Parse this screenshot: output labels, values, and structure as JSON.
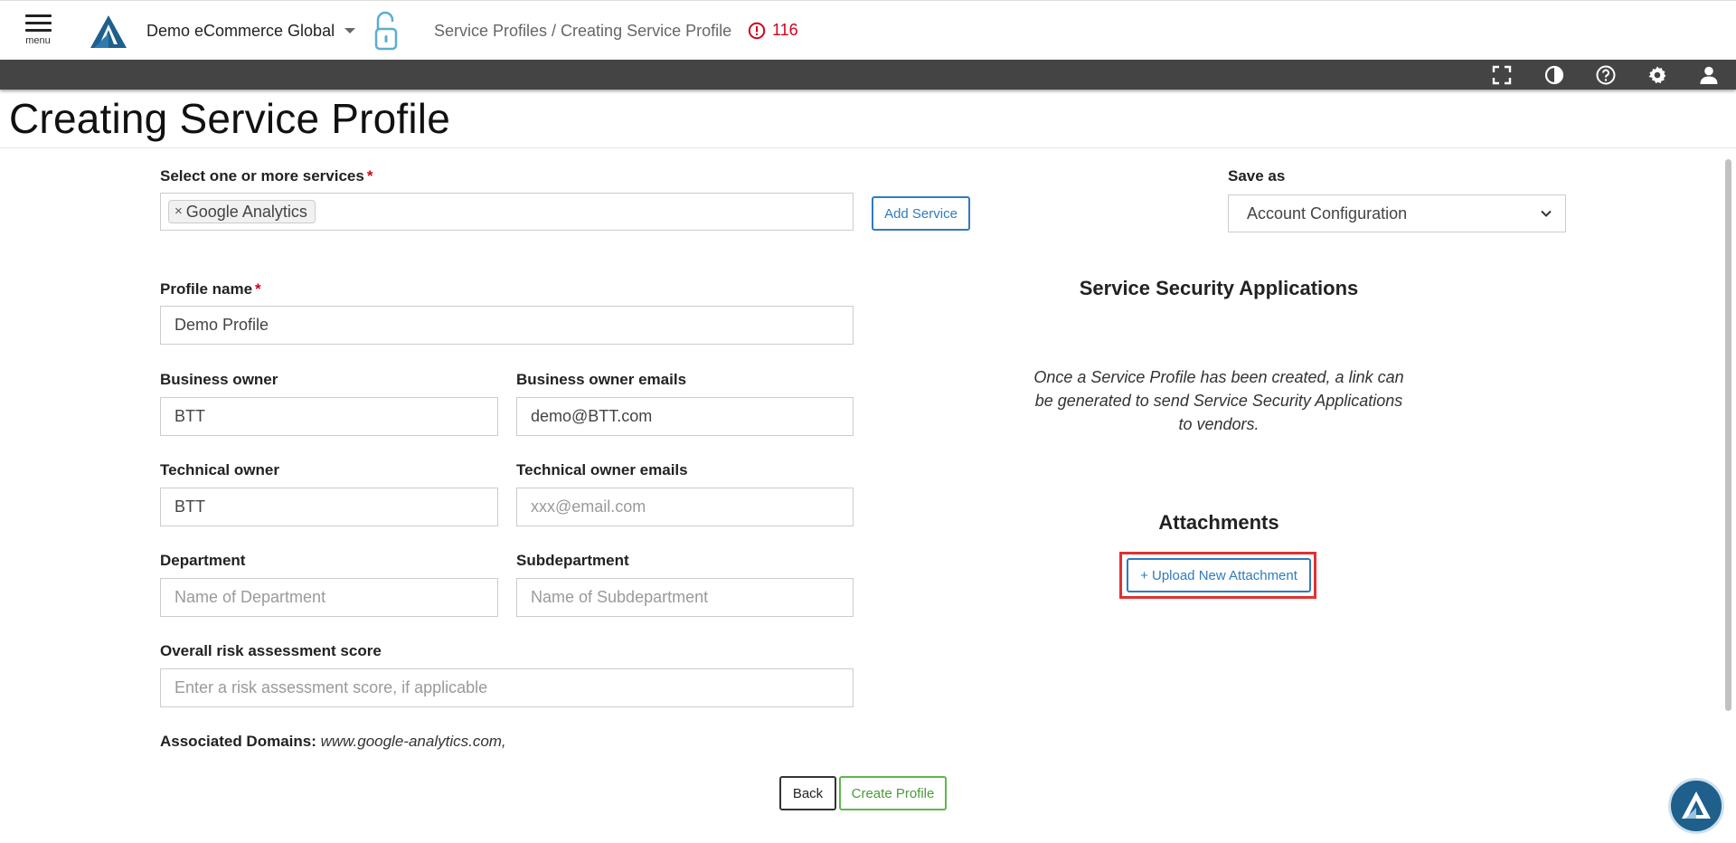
{
  "header": {
    "menu_label": "menu",
    "org_name": "Demo eCommerce Global",
    "breadcrumb": "Service Profiles / Creating Service Profile",
    "alert_count": "116"
  },
  "toolbar": {
    "icons": [
      "fullscreen-icon",
      "contrast-icon",
      "help-icon",
      "settings-icon",
      "user-icon"
    ]
  },
  "page": {
    "title": "Creating Service Profile"
  },
  "form": {
    "services_label": "Select one or more services",
    "required_mark": "*",
    "selected_services": [
      "Google Analytics"
    ],
    "chip_remove": "×",
    "add_service_label": "Add Service",
    "save_as_label": "Save as",
    "save_as_value": "Account Configuration",
    "profile_name_label": "Profile name",
    "profile_name_value": "Demo Profile",
    "business_owner_label": "Business owner",
    "business_owner_value": "BTT",
    "business_owner_emails_label": "Business owner emails",
    "business_owner_emails_value": "demo@BTT.com",
    "technical_owner_label": "Technical owner",
    "technical_owner_value": "BTT",
    "technical_owner_emails_label": "Technical owner emails",
    "technical_owner_emails_placeholder": "xxx@email.com",
    "department_label": "Department",
    "department_placeholder": "Name of Department",
    "subdepartment_label": "Subdepartment",
    "subdepartment_placeholder": "Name of Subdepartment",
    "risk_label": "Overall risk assessment score",
    "risk_placeholder": "Enter a risk assessment score, if applicable",
    "domains_label": "Associated Domains:",
    "domains_value": "www.google-analytics.com,"
  },
  "side": {
    "security_heading": "Service Security Applications",
    "security_info": "Once a Service Profile has been created, a link can be generated to send Service Security Applications to vendors.",
    "attachments_heading": "Attachments",
    "upload_label": "+ Upload New Attachment"
  },
  "actions": {
    "back_label": "Back",
    "create_label": "Create Profile"
  },
  "colors": {
    "accent_blue": "#2f7bbf",
    "alert_red": "#d0021b",
    "create_green": "#5cb84a",
    "toolbar_bg": "#444444",
    "highlight_red": "#e03131"
  }
}
